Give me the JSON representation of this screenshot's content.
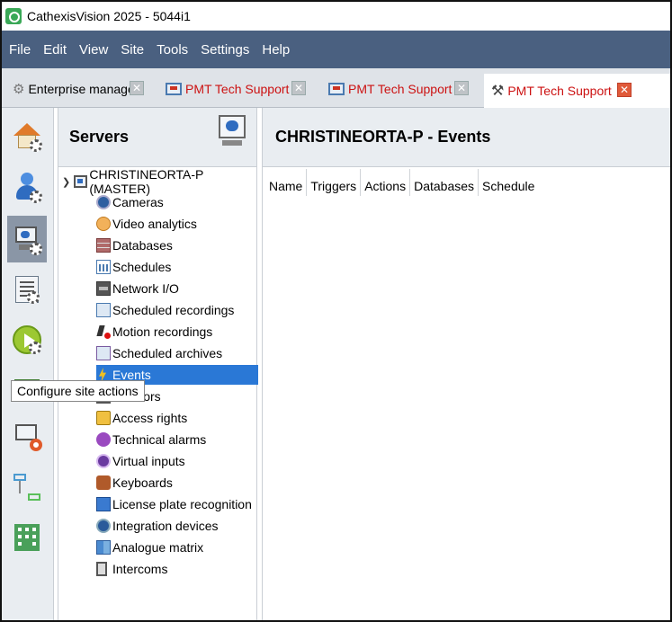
{
  "window": {
    "title": "CathexisVision 2025 - 5044i1"
  },
  "menu": [
    "File",
    "Edit",
    "View",
    "Site",
    "Tools",
    "Settings",
    "Help"
  ],
  "tabs": [
    {
      "label": "Enterprise manager",
      "style": "normal",
      "icon": "enterprise-icon"
    },
    {
      "label": "PMT Tech Support",
      "style": "red",
      "icon": "monitor-icon"
    },
    {
      "label": "PMT Tech Support",
      "style": "red",
      "icon": "monitor-icon"
    },
    {
      "label": "PMT Tech Support",
      "style": "red",
      "icon": "tools-icon",
      "active": true
    }
  ],
  "sidebar": {
    "icons": [
      "site-home-icon",
      "users-icon",
      "servers-icon",
      "reports-icon",
      "site-actions-icon",
      "green-panel-icon",
      "support-icon",
      "flow-icon",
      "building-icon"
    ],
    "selected": "servers-icon"
  },
  "tooltip": "Configure site actions",
  "servers": {
    "title": "Servers",
    "root": "CHRISTINEORTA-P (MASTER)",
    "items": [
      "Cameras",
      "Video analytics",
      "Databases",
      "Schedules",
      "Network I/O",
      "Scheduled recordings",
      "Motion recordings",
      "Scheduled archives",
      "Events",
      "Monitors",
      "Access rights",
      "Technical alarms",
      "Virtual inputs",
      "Keyboards",
      "License plate recognition",
      "Integration devices",
      "Analogue matrix",
      "Intercoms"
    ],
    "selected": "Events"
  },
  "events": {
    "title": "CHRISTINEORTA-P - Events",
    "columns": [
      "Name",
      "Triggers",
      "Actions",
      "Databases",
      "Schedule"
    ]
  },
  "colors": {
    "menubar": "#4a6080",
    "selection": "#2a78d6",
    "tab_red": "#cc1111"
  }
}
